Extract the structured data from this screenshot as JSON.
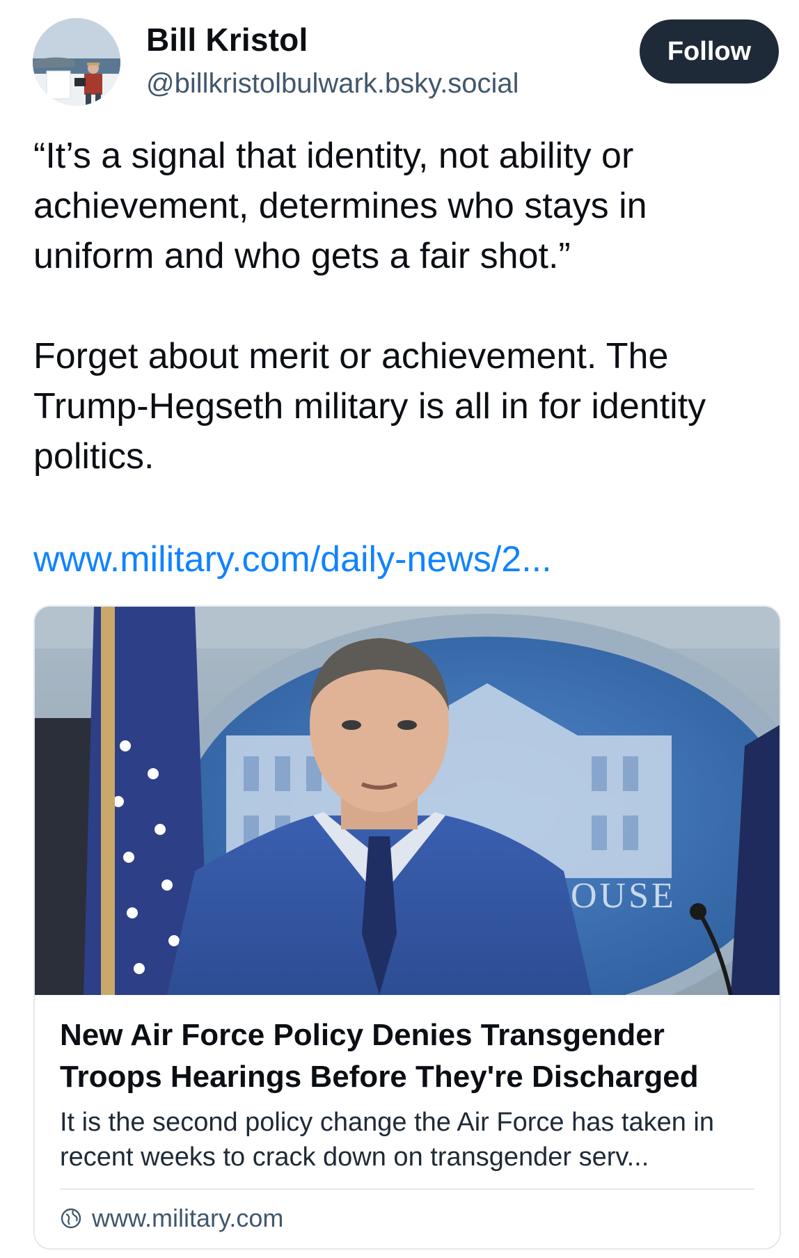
{
  "author": {
    "display_name": "Bill Kristol",
    "handle": "@billkristolbulwark.bsky.social",
    "avatar_icon": "profile-photo"
  },
  "follow_button": {
    "label": "Follow"
  },
  "post": {
    "paragraphs": [
      "“It’s a signal that identity, not ability or achievement, determines who stays in uniform and who gets a fair shot.”",
      "Forget about merit or achievement. The Trump-Hegseth military is all in for identity politics."
    ],
    "link_text": "www.military.com/daily-news/2..."
  },
  "embed": {
    "title": "New Air Force Policy Denies Transgender Troops Hearings Before They're Discharged",
    "description": "It is the second policy change the Air Force has taken in recent weeks to crack down on transgender serv...",
    "domain": "www.military.com",
    "domain_icon": "globe-icon",
    "image_overlay_text": "OUSE"
  },
  "colors": {
    "link": "#1083fe",
    "follow_button_bg": "#1e2a38",
    "handle_text": "#42576c"
  }
}
